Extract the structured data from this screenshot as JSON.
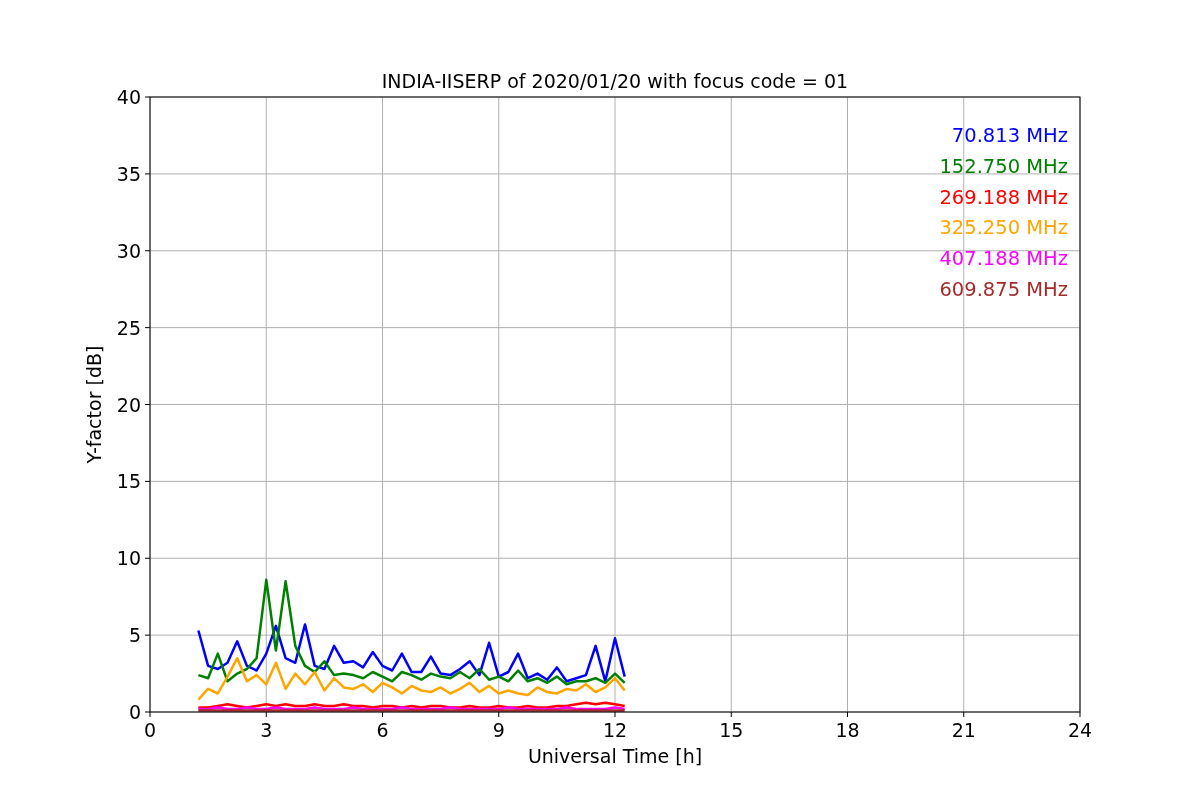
{
  "chart_data": {
    "type": "line",
    "title": "INDIA-IISERP of 2020/01/20 with focus code = 01",
    "xlabel": "Universal Time [h]",
    "ylabel": "Y-factor [dB]",
    "x": [
      1.25,
      1.5,
      1.75,
      2,
      2.25,
      2.5,
      2.75,
      3,
      3.25,
      3.5,
      3.75,
      4,
      4.25,
      4.5,
      4.75,
      5,
      5.25,
      5.5,
      5.75,
      6,
      6.25,
      6.5,
      6.75,
      7,
      7.25,
      7.5,
      7.75,
      8,
      8.25,
      8.5,
      8.75,
      9,
      9.25,
      9.5,
      9.75,
      10,
      10.25,
      10.5,
      10.75,
      11,
      11.25,
      11.5,
      11.75,
      12,
      12.25
    ],
    "series": [
      {
        "name": "70.813 MHz",
        "color": "#0000ff",
        "values": [
          5.3,
          3.0,
          2.8,
          3.2,
          4.6,
          3.0,
          2.7,
          3.8,
          5.6,
          3.5,
          3.2,
          5.7,
          3.0,
          2.8,
          4.3,
          3.2,
          3.3,
          2.9,
          3.9,
          3.0,
          2.7,
          3.8,
          2.6,
          2.6,
          3.6,
          2.5,
          2.4,
          2.8,
          3.3,
          2.4,
          4.5,
          2.3,
          2.6,
          3.8,
          2.2,
          2.5,
          2.1,
          2.9,
          2.0,
          2.2,
          2.4,
          4.3,
          2.0,
          4.8,
          2.3
        ]
      },
      {
        "name": "152.750 MHz",
        "color": "#008000",
        "values": [
          2.4,
          2.2,
          3.8,
          2.0,
          2.5,
          2.8,
          3.5,
          8.6,
          4.0,
          8.5,
          4.3,
          3.0,
          2.6,
          3.3,
          2.4,
          2.5,
          2.4,
          2.2,
          2.6,
          2.3,
          2.0,
          2.6,
          2.4,
          2.1,
          2.5,
          2.3,
          2.2,
          2.6,
          2.2,
          2.8,
          2.1,
          2.3,
          2.0,
          2.7,
          2.0,
          2.2,
          1.9,
          2.3,
          1.8,
          2.0,
          2.0,
          2.2,
          1.9,
          2.5,
          1.9
        ]
      },
      {
        "name": "269.188 MHz",
        "color": "#ff0000",
        "values": [
          0.3,
          0.3,
          0.4,
          0.5,
          0.4,
          0.3,
          0.4,
          0.5,
          0.4,
          0.5,
          0.4,
          0.4,
          0.5,
          0.4,
          0.4,
          0.5,
          0.4,
          0.4,
          0.3,
          0.4,
          0.4,
          0.3,
          0.4,
          0.3,
          0.4,
          0.4,
          0.3,
          0.3,
          0.4,
          0.3,
          0.3,
          0.4,
          0.3,
          0.3,
          0.4,
          0.3,
          0.3,
          0.4,
          0.4,
          0.5,
          0.6,
          0.5,
          0.6,
          0.5,
          0.4
        ]
      },
      {
        "name": "325.250 MHz",
        "color": "#ffa500",
        "values": [
          0.8,
          1.5,
          1.2,
          2.3,
          3.5,
          2.0,
          2.4,
          1.8,
          3.2,
          1.5,
          2.5,
          1.8,
          2.6,
          1.4,
          2.2,
          1.6,
          1.5,
          1.8,
          1.3,
          1.9,
          1.6,
          1.2,
          1.7,
          1.4,
          1.3,
          1.6,
          1.2,
          1.5,
          1.9,
          1.3,
          1.7,
          1.2,
          1.4,
          1.2,
          1.1,
          1.6,
          1.3,
          1.2,
          1.5,
          1.4,
          1.8,
          1.3,
          1.6,
          2.2,
          1.4
        ]
      },
      {
        "name": "407.188 MHz",
        "color": "#ff00ff",
        "values": [
          0.2,
          0.2,
          0.3,
          0.2,
          0.2,
          0.3,
          0.2,
          0.2,
          0.3,
          0.2,
          0.2,
          0.2,
          0.3,
          0.2,
          0.2,
          0.2,
          0.3,
          0.2,
          0.2,
          0.2,
          0.2,
          0.3,
          0.2,
          0.2,
          0.2,
          0.2,
          0.3,
          0.2,
          0.2,
          0.2,
          0.2,
          0.2,
          0.3,
          0.2,
          0.2,
          0.2,
          0.2,
          0.2,
          0.3,
          0.2,
          0.2,
          0.2,
          0.2,
          0.3,
          0.2
        ]
      },
      {
        "name": "609.875 MHz",
        "color": "#a52a2a",
        "values": [
          0.1,
          0.1,
          0.1,
          0.1,
          0.1,
          0.1,
          0.1,
          0.1,
          0.1,
          0.1,
          0.1,
          0.1,
          0.1,
          0.1,
          0.1,
          0.1,
          0.1,
          0.1,
          0.1,
          0.1,
          0.1,
          0.1,
          0.1,
          0.1,
          0.1,
          0.1,
          0.1,
          0.1,
          0.1,
          0.1,
          0.1,
          0.1,
          0.1,
          0.1,
          0.1,
          0.1,
          0.1,
          0.1,
          0.1,
          0.1,
          0.1,
          0.1,
          0.1,
          0.1,
          0.1
        ]
      }
    ],
    "grid": true,
    "xlim": [
      0,
      24
    ],
    "ylim": [
      0,
      40
    ],
    "xticks": [
      0,
      3,
      6,
      9,
      12,
      15,
      18,
      21,
      24
    ],
    "yticks": [
      0,
      5,
      10,
      15,
      20,
      25,
      30,
      35,
      40
    ]
  }
}
